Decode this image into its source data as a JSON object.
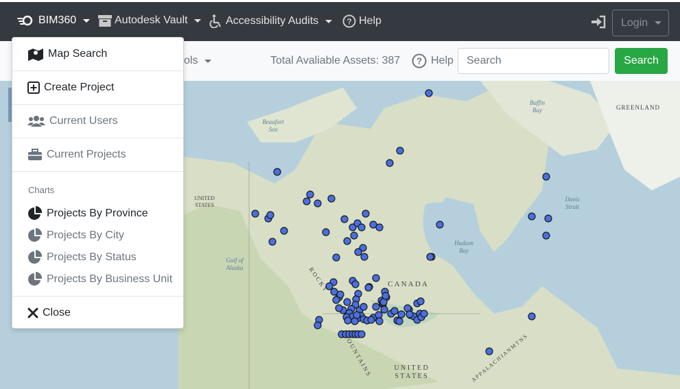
{
  "navbar": {
    "brand": "BIM360",
    "vault": "Autodesk Vault",
    "audits": "Accessibility Audits",
    "help": "Help",
    "login": "Login"
  },
  "toolbar": {
    "tools_fragment": "ols",
    "assets_text": "Total Avaliable Assets: 387",
    "help": "Help",
    "search_placeholder": "Search",
    "search_button": "Search"
  },
  "dropdown": {
    "map_search": "Map Search",
    "create_project": "Create Project",
    "current_users": "Current Users",
    "current_projects": "Current Projects",
    "charts_header": "Charts",
    "by_province": "Projects By Province",
    "by_city": "Projects By City",
    "by_status": "Projects By Status",
    "by_business_unit": "Projects By Business Unit",
    "close": "Close"
  },
  "map": {
    "labels": {
      "beaufort": "Beaufort",
      "sea": "Sea",
      "baffin": "Baffin",
      "bay_baffin": "Bay",
      "greenland": "GREENLAND",
      "united": "UNITED",
      "states": "STATES",
      "davis": "Davis",
      "strait": "Strait",
      "hudson": "Hudson",
      "bay_hudson": "Bay",
      "gulf_of": "Gulf of",
      "alaska": "Alaska",
      "canada": "C A N A D A",
      "rocky": "R O C K Y",
      "mountains": "M O U N T A I N S",
      "united2": "U N I T E D",
      "states2": "S T A T E S",
      "appalachian": "A P P A L A C H I A N   M T N S"
    },
    "marker_color": "#4a6fe0",
    "marker_count_visible": 120
  }
}
